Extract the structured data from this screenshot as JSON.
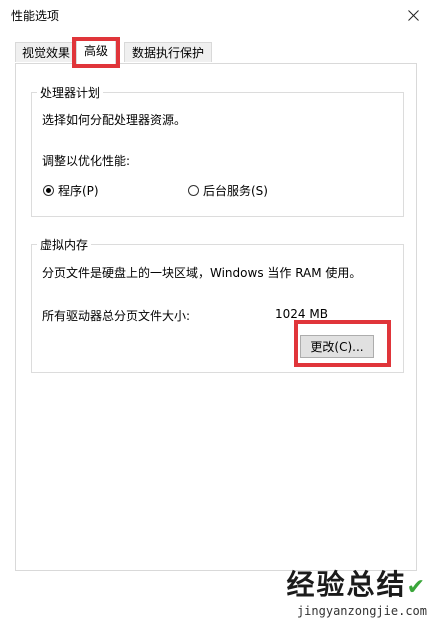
{
  "window": {
    "title": "性能选项"
  },
  "tabs": [
    {
      "label": "视觉效果"
    },
    {
      "label": "高级"
    },
    {
      "label": "数据执行保护"
    }
  ],
  "processor": {
    "legend": "处理器计划",
    "description": "选择如何分配处理器资源。",
    "adjust_label": "调整以优化性能:",
    "options": [
      {
        "label": "程序(P)",
        "checked": true
      },
      {
        "label": "后台服务(S)",
        "checked": false
      }
    ]
  },
  "virtual_memory": {
    "legend": "虚拟内存",
    "description": "分页文件是硬盘上的一块区域，Windows 当作 RAM 使用。",
    "total_label": "所有驱动器总分页文件大小:",
    "total_value": "1024 MB",
    "change_button": "更改(C)..."
  },
  "watermark": {
    "main": "经验总结",
    "url": "jingyanzongjie.com"
  },
  "colors": {
    "highlight": "#e0353a",
    "watermark_check": "#3aa63a"
  },
  "icons": {
    "close": "close-icon"
  }
}
